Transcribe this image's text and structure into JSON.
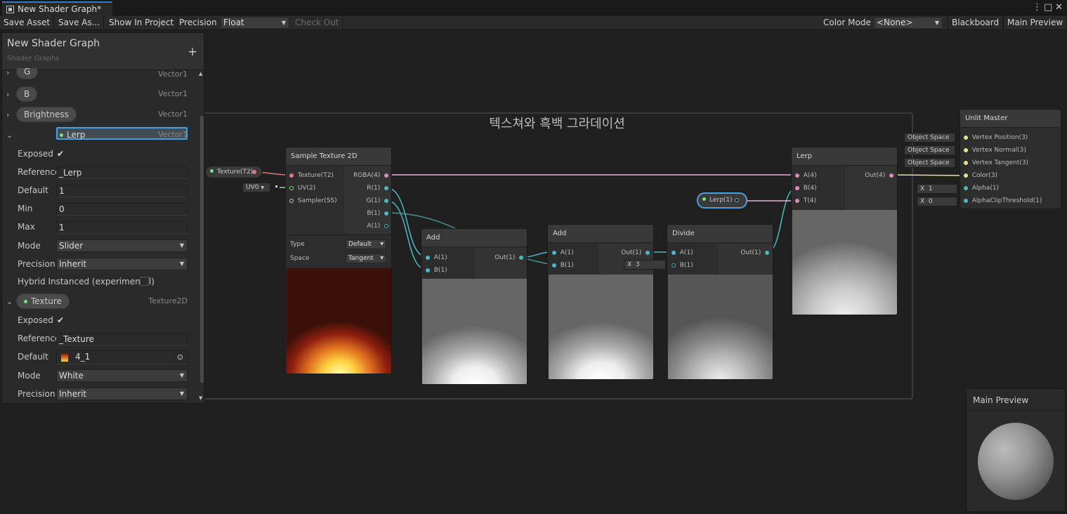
{
  "window": {
    "tab_title": "New Shader Graph*",
    "menu_glyph": "⋮",
    "maximize_glyph": "□",
    "close_glyph": "✕"
  },
  "toolbar": {
    "save_asset": "Save Asset",
    "save_as": "Save As...",
    "show_in_project": "Show In Project",
    "precision_label": "Precision",
    "precision_value": "Float",
    "check_out": "Check Out",
    "color_mode_label": "Color Mode",
    "color_mode_value": "<None>",
    "blackboard": "Blackboard",
    "main_preview": "Main Preview"
  },
  "blackboard": {
    "title": "New Shader Graph",
    "subtitle": "Shader Graphs",
    "add_glyph": "+",
    "properties": [
      {
        "name": "G",
        "type": "Vector1"
      },
      {
        "name": "B",
        "type": "Vector1"
      },
      {
        "name": "Brightness",
        "type": "Vector1"
      },
      {
        "name": "Lerp",
        "type": "Vector1"
      }
    ],
    "lerp": {
      "exposed_label": "Exposed",
      "exposed_check": "✔",
      "reference_label": "Reference",
      "reference": "_Lerp",
      "default_label": "Default",
      "default": "1",
      "min_label": "Min",
      "min": "0",
      "max_label": "Max",
      "max": "1",
      "mode_label": "Mode",
      "mode": "Slider",
      "precision_label": "Precision",
      "precision": "Inherit",
      "hybrid_label": "Hybrid Instanced (experimental)"
    },
    "texture": {
      "name": "Texture",
      "type": "Texture2D",
      "exposed_label": "Exposed",
      "exposed_check": "✔",
      "reference_label": "Reference",
      "reference": "_Texture",
      "default_label": "Default",
      "default": "4_1",
      "mode_label": "Mode",
      "mode": "White",
      "precision_label": "Precision",
      "precision": "Inherit"
    }
  },
  "graph": {
    "group_title": "텍스쳐와 흑백 그라데이션",
    "texture_prop_node": "Texture(T2)",
    "uv_chip": "UV0",
    "lerp_prop_node": "Lerp(1)",
    "sample_texture": {
      "title": "Sample Texture 2D",
      "inputs": [
        "Texture(T2)",
        "UV(2)",
        "Sampler(SS)"
      ],
      "outputs": [
        "RGBA(4)",
        "R(1)",
        "G(1)",
        "B(1)",
        "A(1)"
      ],
      "type_label": "Type",
      "type_value": "Default",
      "space_label": "Space",
      "space_value": "Tangent"
    },
    "add1": {
      "title": "Add",
      "inputs": [
        "A(1)",
        "B(1)"
      ],
      "output": "Out(1)"
    },
    "add2": {
      "title": "Add",
      "inputs": [
        "A(1)",
        "B(1)"
      ],
      "output": "Out(1)",
      "b_axis": "X",
      "b_value": "3"
    },
    "divide": {
      "title": "Divide",
      "inputs": [
        "A(1)",
        "B(1)"
      ],
      "output": "Out(1)"
    },
    "lerp": {
      "title": "Lerp",
      "inputs": [
        "A(4)",
        "B(4)",
        "T(4)"
      ],
      "output": "Out(4)"
    },
    "master": {
      "title": "Unlit Master",
      "inputs": [
        "Vertex Position(3)",
        "Vertex Normal(3)",
        "Vertex Tangent(3)",
        "Color(3)",
        "Alpha(1)",
        "AlphaClipThreshold(1)"
      ],
      "space_chips": [
        "Object Space",
        "Object Space",
        "Object Space"
      ],
      "alpha_axis": "X",
      "alpha_value": "1",
      "clip_axis": "X",
      "clip_value": "0"
    }
  },
  "main_preview": {
    "title": "Main Preview"
  },
  "colors": {
    "accent": "#4aa0dd",
    "wire_float": "#4db7c4",
    "wire_vec4": "#e08ab8",
    "wire_vec3": "#e8e28a",
    "wire_tex": "#e07a7a"
  }
}
